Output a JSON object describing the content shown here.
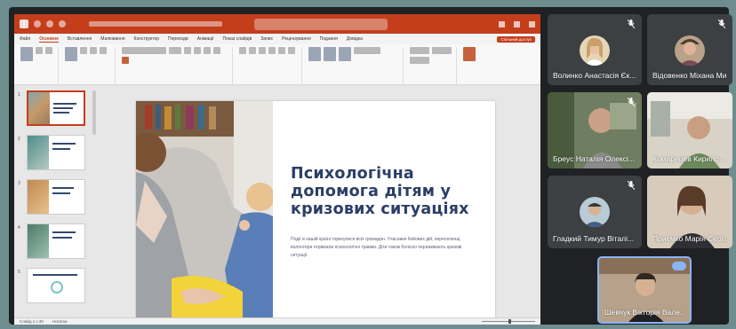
{
  "powerpoint": {
    "ribbon_tabs": [
      "Файл",
      "Основне",
      "Вставлення",
      "Малювання",
      "Конструктор",
      "Переходи",
      "Анімації",
      "Показ слайдів",
      "Запис",
      "Рецензування",
      "Подання",
      "Довідка"
    ],
    "active_tab": "Основне",
    "share_label": "Спільний доступ",
    "slide_numbers": [
      "1",
      "2",
      "3",
      "4",
      "5"
    ],
    "slide": {
      "title": "Психологічна допомога дітям у кризових ситуаціях",
      "body": "Події в нашій країні торкнулися всіх громадян. Учасники бойових дій, переселенці, волонтери отримали психологічні травми. Діти також болісно переживають кризові ситуації."
    },
    "status": {
      "slide_count": "Слайд 1 з 30",
      "notes": "Нотатки"
    }
  },
  "participants": [
    {
      "name": "Волинко Анастасія Єк..."
    },
    {
      "name": "Відовенко Міхана Мик..."
    },
    {
      "name": "Бреус Наталія Олексі..."
    },
    {
      "name": "Комарецев Кирило..."
    },
    {
      "name": "Гладкий Тимур Віталі..."
    },
    {
      "name": "Приємко Марія Сергі..."
    },
    {
      "name": "Шевчук Вікторія Вале..."
    }
  ],
  "colors": {
    "ppt_accent": "#c43e1c",
    "slide_title": "#2a3f66",
    "meet_bg": "#202124",
    "tile_bg": "#3c4043",
    "active_speaker": "#8ab4f8"
  }
}
